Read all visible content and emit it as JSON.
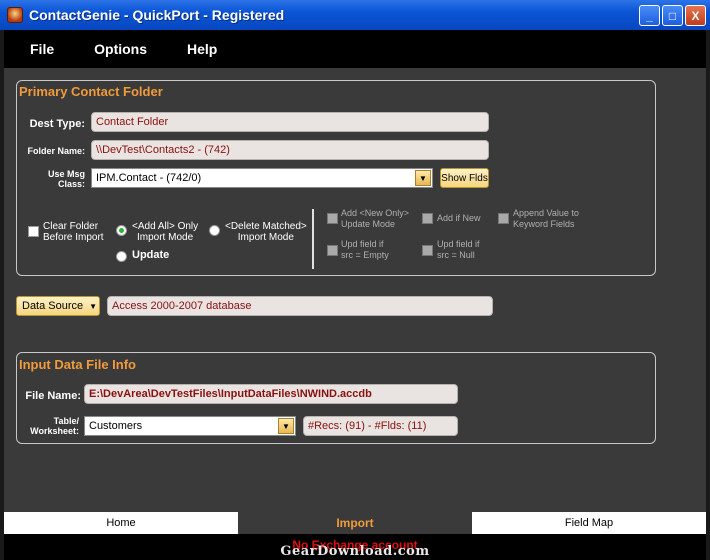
{
  "window": {
    "title": "ContactGenie - QuickPort - Registered",
    "buttons": [
      "_",
      "□",
      "X"
    ]
  },
  "menu": [
    "File",
    "Options",
    "Help"
  ],
  "primary": {
    "title": "Primary Contact Folder",
    "dest_type_label": "Dest Type:",
    "dest_type_value": "Contact Folder",
    "folder_name_label": "Folder Name:",
    "folder_name_value": "\\\\DevTest\\Contacts2 - (742)",
    "msg_class_label_1": "Use Msg",
    "msg_class_label_2": "Class:",
    "msg_class_value": "IPM.Contact - (742/0)",
    "show_flds": "Show Flds",
    "clear_folder_1": "Clear Folder",
    "clear_folder_2": "Before Import",
    "add_all_1": "<Add All> Only",
    "add_all_2": "Import Mode",
    "delete_matched_1": "<Delete Matched>",
    "delete_matched_2": "Import Mode",
    "update": "Update",
    "add_new_1": "Add <New Only>",
    "add_new_2": "Update Mode",
    "add_if_new": "Add if New",
    "append_1": "Append Value to",
    "append_2": "Keyword Fields",
    "upd_empty_1": "Upd field if",
    "upd_empty_2": "src =  Empty",
    "upd_null_1": "Upd field if",
    "upd_null_2": "src = Null"
  },
  "data_source": {
    "button": "Data Source",
    "value": "Access 2000-2007 database"
  },
  "input_info": {
    "title": "Input Data File Info",
    "file_label": "File Name:",
    "file_value": "E:\\DevArea\\DevTestFiles\\InputDataFiles\\NWIND.accdb",
    "table_label_1": "Table/",
    "table_label_2": "Worksheet:",
    "table_value": "Customers",
    "recs": "#Recs: (91) - #Flds: (11)"
  },
  "tabs": [
    "Home",
    "Import",
    "Field Map"
  ],
  "status": "No Exchange account",
  "watermark": "GearDownload.com"
}
